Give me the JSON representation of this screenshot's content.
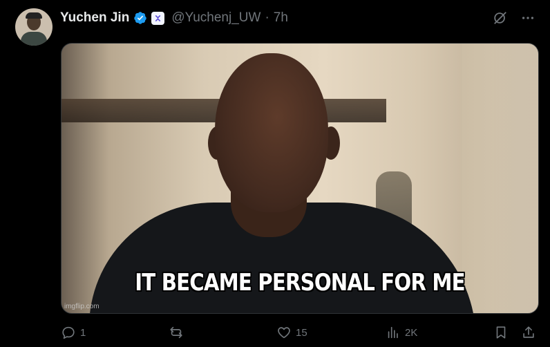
{
  "author": {
    "name": "Yuchen Jin",
    "handle": "@Yuchenj_UW",
    "separator": "·",
    "time": "7h"
  },
  "media": {
    "caption": "IT BECAME PERSONAL FOR ME",
    "watermark": "imgflip.com"
  },
  "actions": {
    "replies": "1",
    "reposts": "",
    "likes": "15",
    "views": "2K"
  },
  "icons": {
    "verified": "verified-badge-icon",
    "org": "affiliate-badge-icon",
    "grok": "grok-icon",
    "more": "more-icon",
    "reply": "reply-icon",
    "repost": "repost-icon",
    "like": "like-icon",
    "views": "views-icon",
    "bookmark": "bookmark-icon",
    "share": "share-icon"
  },
  "colors": {
    "background": "#000000",
    "text": "#e7e9ea",
    "muted": "#71767b",
    "verified": "#1d9bf0"
  }
}
